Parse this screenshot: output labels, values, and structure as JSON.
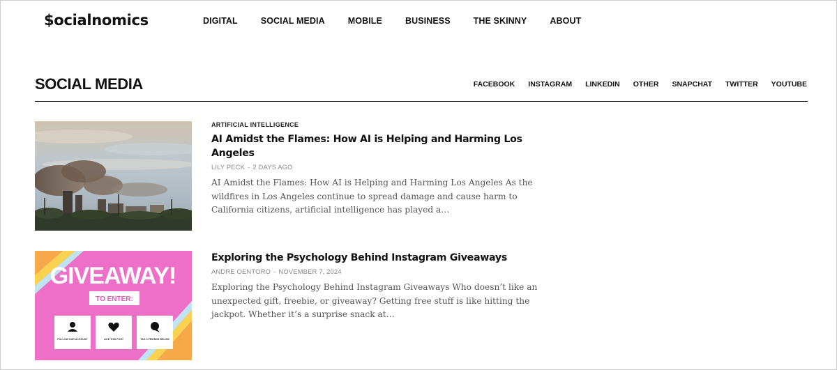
{
  "header": {
    "logo": "$ocialnomics",
    "nav": [
      "DIGITAL",
      "SOCIAL MEDIA",
      "MOBILE",
      "BUSINESS",
      "THE SKINNY",
      "ABOUT"
    ]
  },
  "section": {
    "title": "SOCIAL MEDIA",
    "subnav": [
      "FACEBOOK",
      "INSTAGRAM",
      "LINKEDIN",
      "OTHER",
      "SNAPCHAT",
      "TWITTER",
      "YOUTUBE"
    ]
  },
  "articles": [
    {
      "category": "ARTIFICIAL INTELLIGENCE",
      "title": "AI Amidst the Flames: How AI is Helping and Harming Los Angeles",
      "author": "LILY PECK",
      "date": "2 DAYS AGO",
      "excerpt": "AI Amidst the Flames: How AI is Helping and Harming Los Angeles As the wildfires in Los Angeles continue to spread damage and cause harm to California citizens, artificial intelligence has played a…",
      "image_icon": "city-wildfire-photo"
    },
    {
      "category": "",
      "title": "Exploring the Psychology Behind Instagram Giveaways",
      "author": "ANDRE OENTORO",
      "date": "NOVEMBER 7, 2024",
      "excerpt": "Exploring the Psychology Behind Instagram Giveaways Who doesn’t like an unexpected gift, freebie, or giveaway? Getting free stuff is like hitting the jackpot. Whether it’s a surprise snack at…",
      "image_icon": "giveaway-graphic",
      "image_text": {
        "headline": "GIVEAWAY!",
        "enter": "TO ENTER:",
        "steps": [
          "FOLLOW OUR ACCOUNT",
          "LIKE THIS POST",
          "TAG 3 FRIENDS BELOW"
        ]
      }
    }
  ],
  "colors": {
    "giveaway_pink": "#ee6fc8",
    "giveaway_orange": "#f7a94a",
    "text_dark": "#111111",
    "meta_gray": "#8a8a8a"
  }
}
